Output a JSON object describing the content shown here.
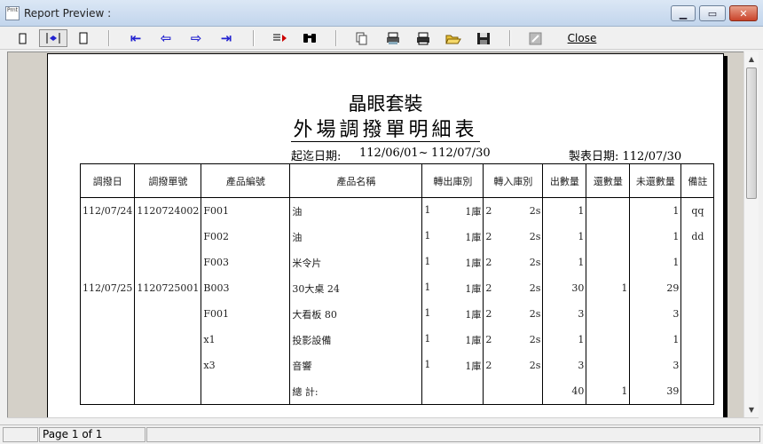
{
  "window": {
    "title": "Report Preview :",
    "icon_label": "Prnt"
  },
  "toolbar": {
    "close_label": "Close"
  },
  "report": {
    "company": "晶眼套裝",
    "title": "外場調撥單明細表",
    "date_range_label": "起迄日期:",
    "date_from": "112/06/01~",
    "date_to": "112/07/30",
    "print_date": "製表日期: 112/07/30",
    "columns": [
      "調撥日",
      "調撥單號",
      "產品編號",
      "產品名稱",
      "轉出庫別",
      "轉入庫別",
      "出數量",
      "還數量",
      "未還數量",
      "備註"
    ],
    "rows": [
      {
        "date": "112/07/24",
        "doc_no": "1120724002",
        "product_code": "F001",
        "product_name": "油",
        "out_code": "1",
        "out_name": "1庫",
        "in_code": "2",
        "in_name": "2s",
        "out_qty": "1",
        "ret_qty": "",
        "unret_qty": "1",
        "note": "qq"
      },
      {
        "date": "",
        "doc_no": "",
        "product_code": "F002",
        "product_name": "油",
        "out_code": "1",
        "out_name": "1庫",
        "in_code": "2",
        "in_name": "2s",
        "out_qty": "1",
        "ret_qty": "",
        "unret_qty": "1",
        "note": "dd"
      },
      {
        "date": "",
        "doc_no": "",
        "product_code": "F003",
        "product_name": "米令片",
        "out_code": "1",
        "out_name": "1庫",
        "in_code": "2",
        "in_name": "2s",
        "out_qty": "1",
        "ret_qty": "",
        "unret_qty": "1",
        "note": ""
      },
      {
        "date": "112/07/25",
        "doc_no": "1120725001",
        "product_code": "B003",
        "product_name": "30大桌 24",
        "out_code": "1",
        "out_name": "1庫",
        "in_code": "2",
        "in_name": "2s",
        "out_qty": "30",
        "ret_qty": "1",
        "unret_qty": "29",
        "note": ""
      },
      {
        "date": "",
        "doc_no": "",
        "product_code": "F001",
        "product_name": "大看板 80",
        "out_code": "1",
        "out_name": "1庫",
        "in_code": "2",
        "in_name": "2s",
        "out_qty": "3",
        "ret_qty": "",
        "unret_qty": "3",
        "note": ""
      },
      {
        "date": "",
        "doc_no": "",
        "product_code": "x1",
        "product_name": "投影設備",
        "out_code": "1",
        "out_name": "1庫",
        "in_code": "2",
        "in_name": "2s",
        "out_qty": "1",
        "ret_qty": "",
        "unret_qty": "1",
        "note": ""
      },
      {
        "date": "",
        "doc_no": "",
        "product_code": "x3",
        "product_name": "音響",
        "out_code": "1",
        "out_name": "1庫",
        "in_code": "2",
        "in_name": "2s",
        "out_qty": "3",
        "ret_qty": "",
        "unret_qty": "3",
        "note": ""
      }
    ],
    "total": {
      "label": "總 計:",
      "out_qty": "40",
      "ret_qty": "1",
      "unret_qty": "39"
    }
  },
  "status": {
    "page_label": "Page 1 of 1"
  }
}
